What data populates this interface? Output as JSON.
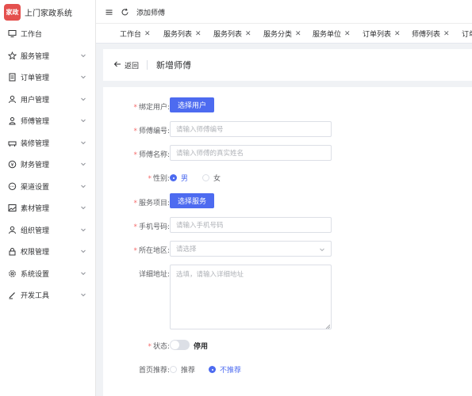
{
  "app": {
    "logo_text": "家政",
    "title": "上门家政系统"
  },
  "sidebar": {
    "items": [
      {
        "label": "工作台",
        "icon": "monitor-icon",
        "has_children": false
      },
      {
        "label": "服务管理",
        "icon": "star-icon",
        "has_children": true
      },
      {
        "label": "订单管理",
        "icon": "document-icon",
        "has_children": true
      },
      {
        "label": "用户管理",
        "icon": "user-icon",
        "has_children": true
      },
      {
        "label": "师傅管理",
        "icon": "worker-icon",
        "has_children": true
      },
      {
        "label": "装修管理",
        "icon": "sofa-icon",
        "has_children": true
      },
      {
        "label": "财务管理",
        "icon": "yen-circle-icon",
        "has_children": true
      },
      {
        "label": "渠道设置",
        "icon": "chat-icon",
        "has_children": true
      },
      {
        "label": "素材管理",
        "icon": "image-icon",
        "has_children": true
      },
      {
        "label": "组织管理",
        "icon": "person-icon",
        "has_children": true
      },
      {
        "label": "权限管理",
        "icon": "lock-icon",
        "has_children": true
      },
      {
        "label": "系统设置",
        "icon": "gear-icon",
        "has_children": true
      },
      {
        "label": "开发工具",
        "icon": "pen-icon",
        "has_children": true
      }
    ]
  },
  "header": {
    "breadcrumb": "添加师傅"
  },
  "tabs": [
    {
      "label": "工作台"
    },
    {
      "label": "服务列表"
    },
    {
      "label": "服务列表"
    },
    {
      "label": "服务分类"
    },
    {
      "label": "服务单位"
    },
    {
      "label": "订单列表"
    },
    {
      "label": "师傅列表"
    },
    {
      "label": "订单"
    }
  ],
  "page": {
    "back_label": "返回",
    "title": "新增师傅"
  },
  "form": {
    "bind_user": {
      "label": "绑定用户:",
      "button": "选择用户"
    },
    "worker_no": {
      "label": "师傅编号:",
      "placeholder": "请输入师傅编号"
    },
    "worker_name": {
      "label": "师傅名称:",
      "placeholder": "请输入师傅的真实姓名"
    },
    "gender": {
      "label": "性别:",
      "options": [
        "男",
        "女"
      ],
      "selected": "男"
    },
    "service": {
      "label": "服务项目:",
      "button": "选择服务"
    },
    "phone": {
      "label": "手机号码:",
      "placeholder": "请输入手机号码"
    },
    "region": {
      "label": "所在地区:",
      "placeholder": "请选择"
    },
    "address": {
      "label": "详细地址:",
      "placeholder": "选填，请输入详细地址"
    },
    "status": {
      "label": "状态:",
      "text": "停用",
      "enabled": false
    },
    "homepage": {
      "label": "首页推荐:",
      "options": [
        "推荐",
        "不推荐"
      ],
      "selected": "不推荐"
    }
  },
  "colors": {
    "primary": "#4d6bf0",
    "required": "#f56c6c",
    "logo": "#e4504e"
  }
}
